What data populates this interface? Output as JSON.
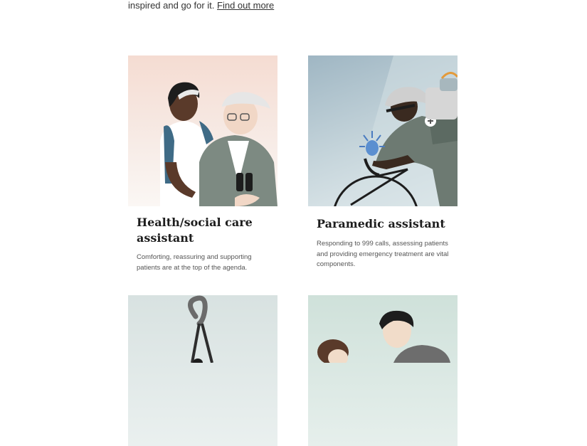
{
  "intro": {
    "text": "inspired and go for it.",
    "link": "Find out more"
  },
  "cards": [
    {
      "title": "Health/social care assistant",
      "description": "Comforting, reassuring and supporting patients are at the top of the agenda.",
      "illustration": "carer-with-elderly-man"
    },
    {
      "title": "Paramedic assistant",
      "description": "Responding to 999 calls, assessing patients and providing emergency treatment are vital components.",
      "illustration": "paramedic-on-bicycle"
    },
    {
      "illustration": "stethoscope"
    },
    {
      "illustration": "two-people"
    }
  ],
  "colors": {
    "card1_bg": "#f5dcd2",
    "card2_bg": "#b9cbd4",
    "card3_bg": "#dfe7e6",
    "card4_bg": "#d6e6e0"
  }
}
